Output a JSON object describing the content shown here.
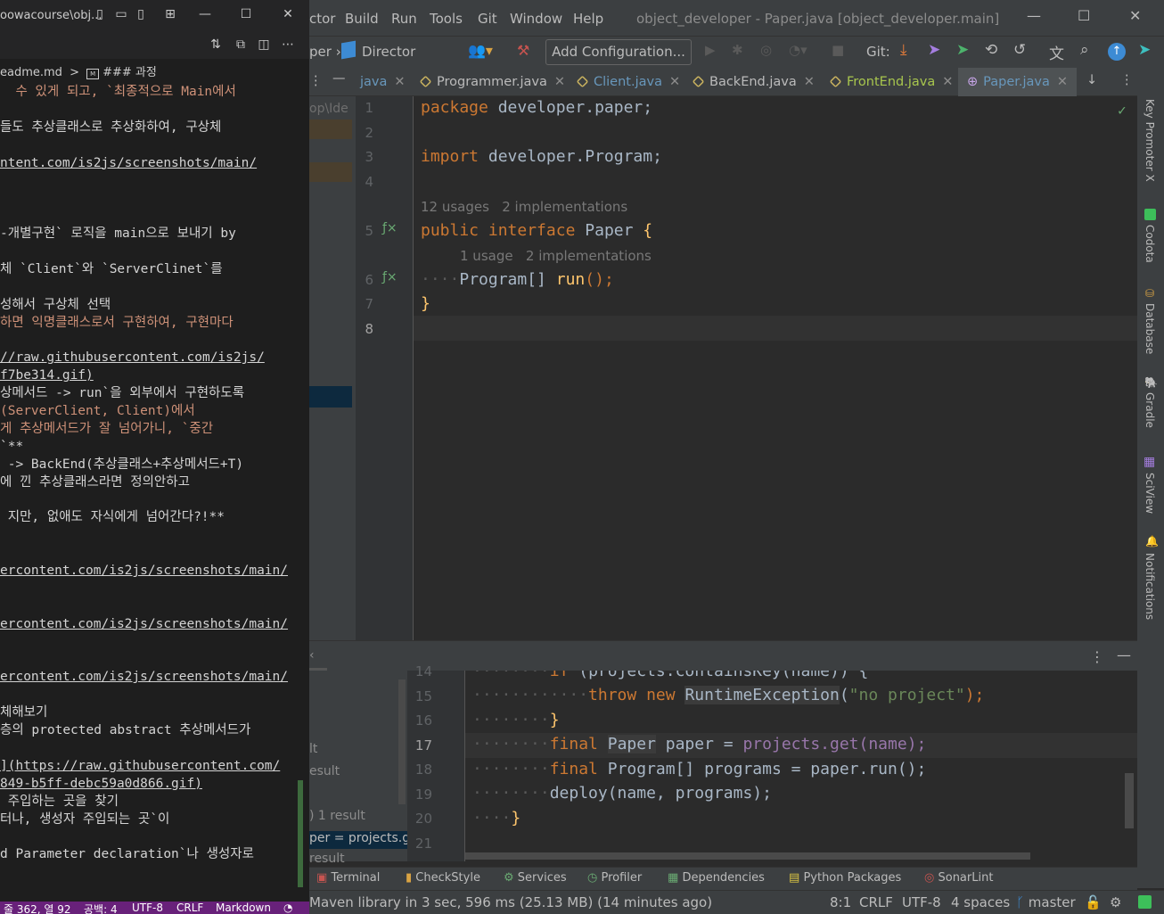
{
  "vscode": {
    "title": "oowacourse\\obj...",
    "breadcrumb_file": "eadme.md",
    "breadcrumb_sep": ">",
    "breadcrumb_section": "### 과정",
    "lines": [
      "  수 있게 되고, `최종적으로 Main에서",
      "",
      "들도 추상클래스로 추상화하여, 구상체",
      "",
      "ntent.com/is2js/screenshots/main/",
      "",
      "",
      "",
      "-개별구현` 로직을 main으로 보내기 by",
      "",
      "체 `Client`와 `ServerClinet`를",
      "",
      "성해서 구상체 선택",
      "하면 익명클래스로서 구현하여, 구현마다",
      "",
      "//raw.githubusercontent.com/is2js/",
      "f7be314.gif)",
      "상메서드 -> run`을 외부에서 구현하도록",
      "(ServerClient, Client)에서",
      "게 추상메서드가 잘 넘어가니, `중간",
      "`**",
      " -> BackEnd(추상클래스+추상메서드+T)",
      "에 낀 추상클래스라면 정의안하고",
      "",
      " 지만, 없애도 자식에게 넘어간다?!**",
      "",
      "",
      "ercontent.com/is2js/screenshots/main/",
      "",
      "",
      "ercontent.com/is2js/screenshots/main/",
      "",
      "",
      "ercontent.com/is2js/screenshots/main/",
      "",
      "체해보기",
      "층의 protected abstract 추상메서드가",
      "",
      "](https://raw.githubusercontent.com/",
      "849-b5ff-debc59a0d866.gif)",
      " 주입하는 곳을 찾기",
      "터나, 생성자 주입되는 곳`이",
      "",
      "d Parameter declaration`나 생성자로"
    ],
    "status": {
      "position": "줄 362, 열 92",
      "spaces": "공백: 4",
      "encoding": "UTF-8",
      "eol": "CRLF",
      "language": "Markdown"
    }
  },
  "intellij": {
    "menu": [
      "ctor",
      "Build",
      "Run",
      "Tools",
      "Git",
      "Window",
      "Help"
    ],
    "window_title": "object_developer - Paper.java [object_developer.main]",
    "nav": {
      "crumb_prev": "per",
      "crumb": "Director",
      "add_config": "Add Configuration...",
      "git_label": "Git:"
    },
    "tabs": [
      {
        "label": "java",
        "active": false
      },
      {
        "label": "Programmer.java",
        "active": false
      },
      {
        "label": "Client.java",
        "active": false
      },
      {
        "label": "BackEnd.java",
        "active": false
      },
      {
        "label": "FrontEnd.java",
        "active": false
      },
      {
        "label": "Paper.java",
        "active": true
      }
    ],
    "project_strip_text": "op\\Ide",
    "editor": {
      "line_numbers": [
        "1",
        "2",
        "3",
        "4",
        "5",
        "6",
        "7",
        "8"
      ],
      "hint1": "12 usages   2 implementations",
      "hint2": "1 usage   2 implementations",
      "code": {
        "l1_kw": "package",
        "l1_rest": " developer.paper;",
        "l3_kw": "import",
        "l3_rest": " developer.Program;",
        "l5_kw1": "public",
        "l5_kw2": "interface",
        "l5_name": "Paper",
        "l5_brace": "{",
        "l6_type": "Program[]",
        "l6_fn": "run",
        "l6_rest": "();",
        "l7": "}"
      }
    },
    "right_tools": [
      "Key Promoter X",
      "Codota",
      "Database",
      "Gradle",
      "SciView",
      "Notifications"
    ],
    "bottom": {
      "left_items": [
        "lt",
        "esult",
        ")  1 result",
        "per = projects.ge",
        "result"
      ],
      "line_numbers": [
        "14",
        "15",
        "16",
        "17",
        "18",
        "19",
        "20",
        "21"
      ],
      "lines": [
        {
          "t": "if (projects.containsKey(name)) {"
        },
        {
          "t": "throw new RuntimeException(\"no project\");"
        },
        {
          "t": "}"
        },
        {
          "t": "final Paper paper = projects.get(name);"
        },
        {
          "t": "final Program[] programs = paper.run();"
        },
        {
          "t": "deploy(name, programs);"
        },
        {
          "t": "}"
        },
        {
          "t": ""
        }
      ],
      "code": {
        "l15_kw": "throw new",
        "l15_cls": "RuntimeException",
        "l15_str": "\"no project\"",
        "l15_end": ");",
        "l17_kw": "final",
        "l17_cls": "Paper",
        "l17_rest": " paper = ",
        "l17_call": "projects.get(name);",
        "l18_kw": "final",
        "l18_rest": " Program[] programs = paper.run();",
        "l19": "deploy(name, programs);"
      }
    },
    "toolwindows": [
      "Terminal",
      "CheckStyle",
      "Services",
      "Profiler",
      "Dependencies",
      "Python Packages",
      "SonarLint"
    ],
    "status": {
      "message": "Maven library in 3 sec, 596 ms (25.13 MB) (14 minutes ago)",
      "position": "8:1",
      "eol": "CRLF",
      "encoding": "UTF-8",
      "indent": "4 spaces",
      "branch": "master"
    }
  },
  "colors": {
    "vscode_status": "#68217a",
    "tab_active_underline": "#4a88c7",
    "keyword": "#cc7832",
    "function": "#ffc66d",
    "string": "#6a8759"
  }
}
